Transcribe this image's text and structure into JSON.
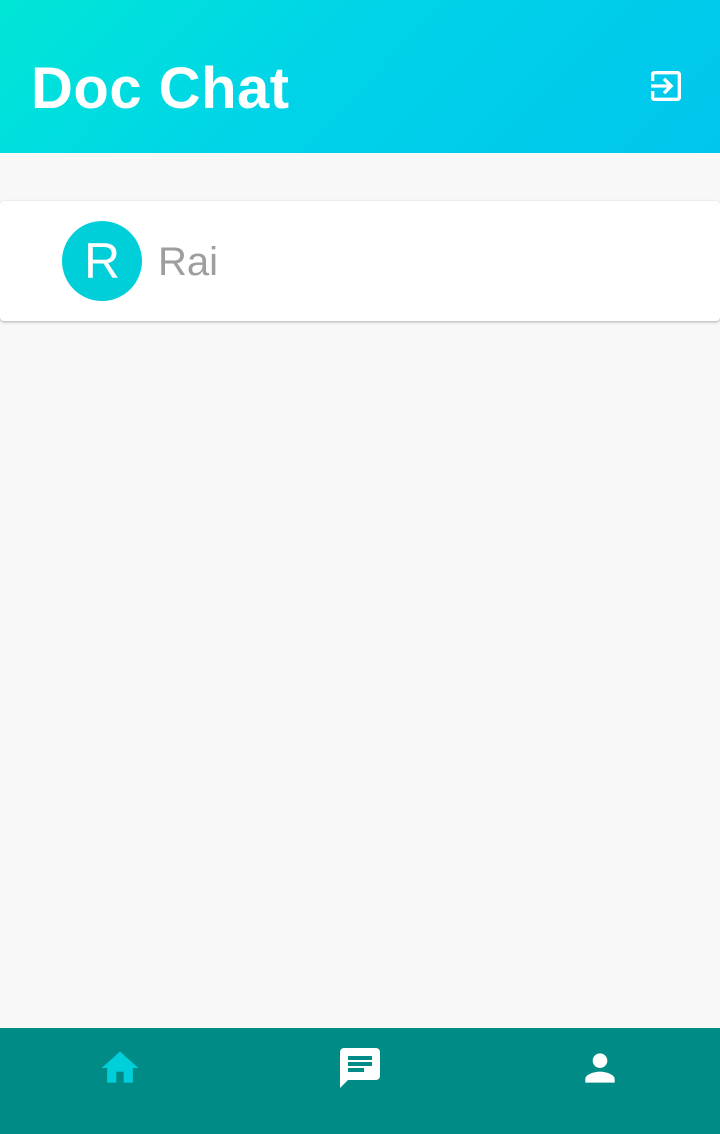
{
  "app_bar": {
    "title": "Doc Chat",
    "logout_icon": "exit-to-app-icon"
  },
  "chat_list": [
    {
      "initial": "R",
      "name": "Rai",
      "avatar_color": "#00cfd9"
    }
  ],
  "bottom_nav": {
    "items": [
      {
        "icon": "home-icon",
        "selected": true
      },
      {
        "icon": "chat-icon",
        "selected": false
      },
      {
        "icon": "person-icon",
        "selected": false
      }
    ]
  },
  "colors": {
    "header_gradient_start": "#00e6d6",
    "header_gradient_end": "#00c6ec",
    "nav_background": "#008b87",
    "nav_selected": "#00cfd9",
    "nav_unselected": "#ffffff",
    "content_background": "#f8f8f8",
    "name_text": "#9e9e9e"
  }
}
